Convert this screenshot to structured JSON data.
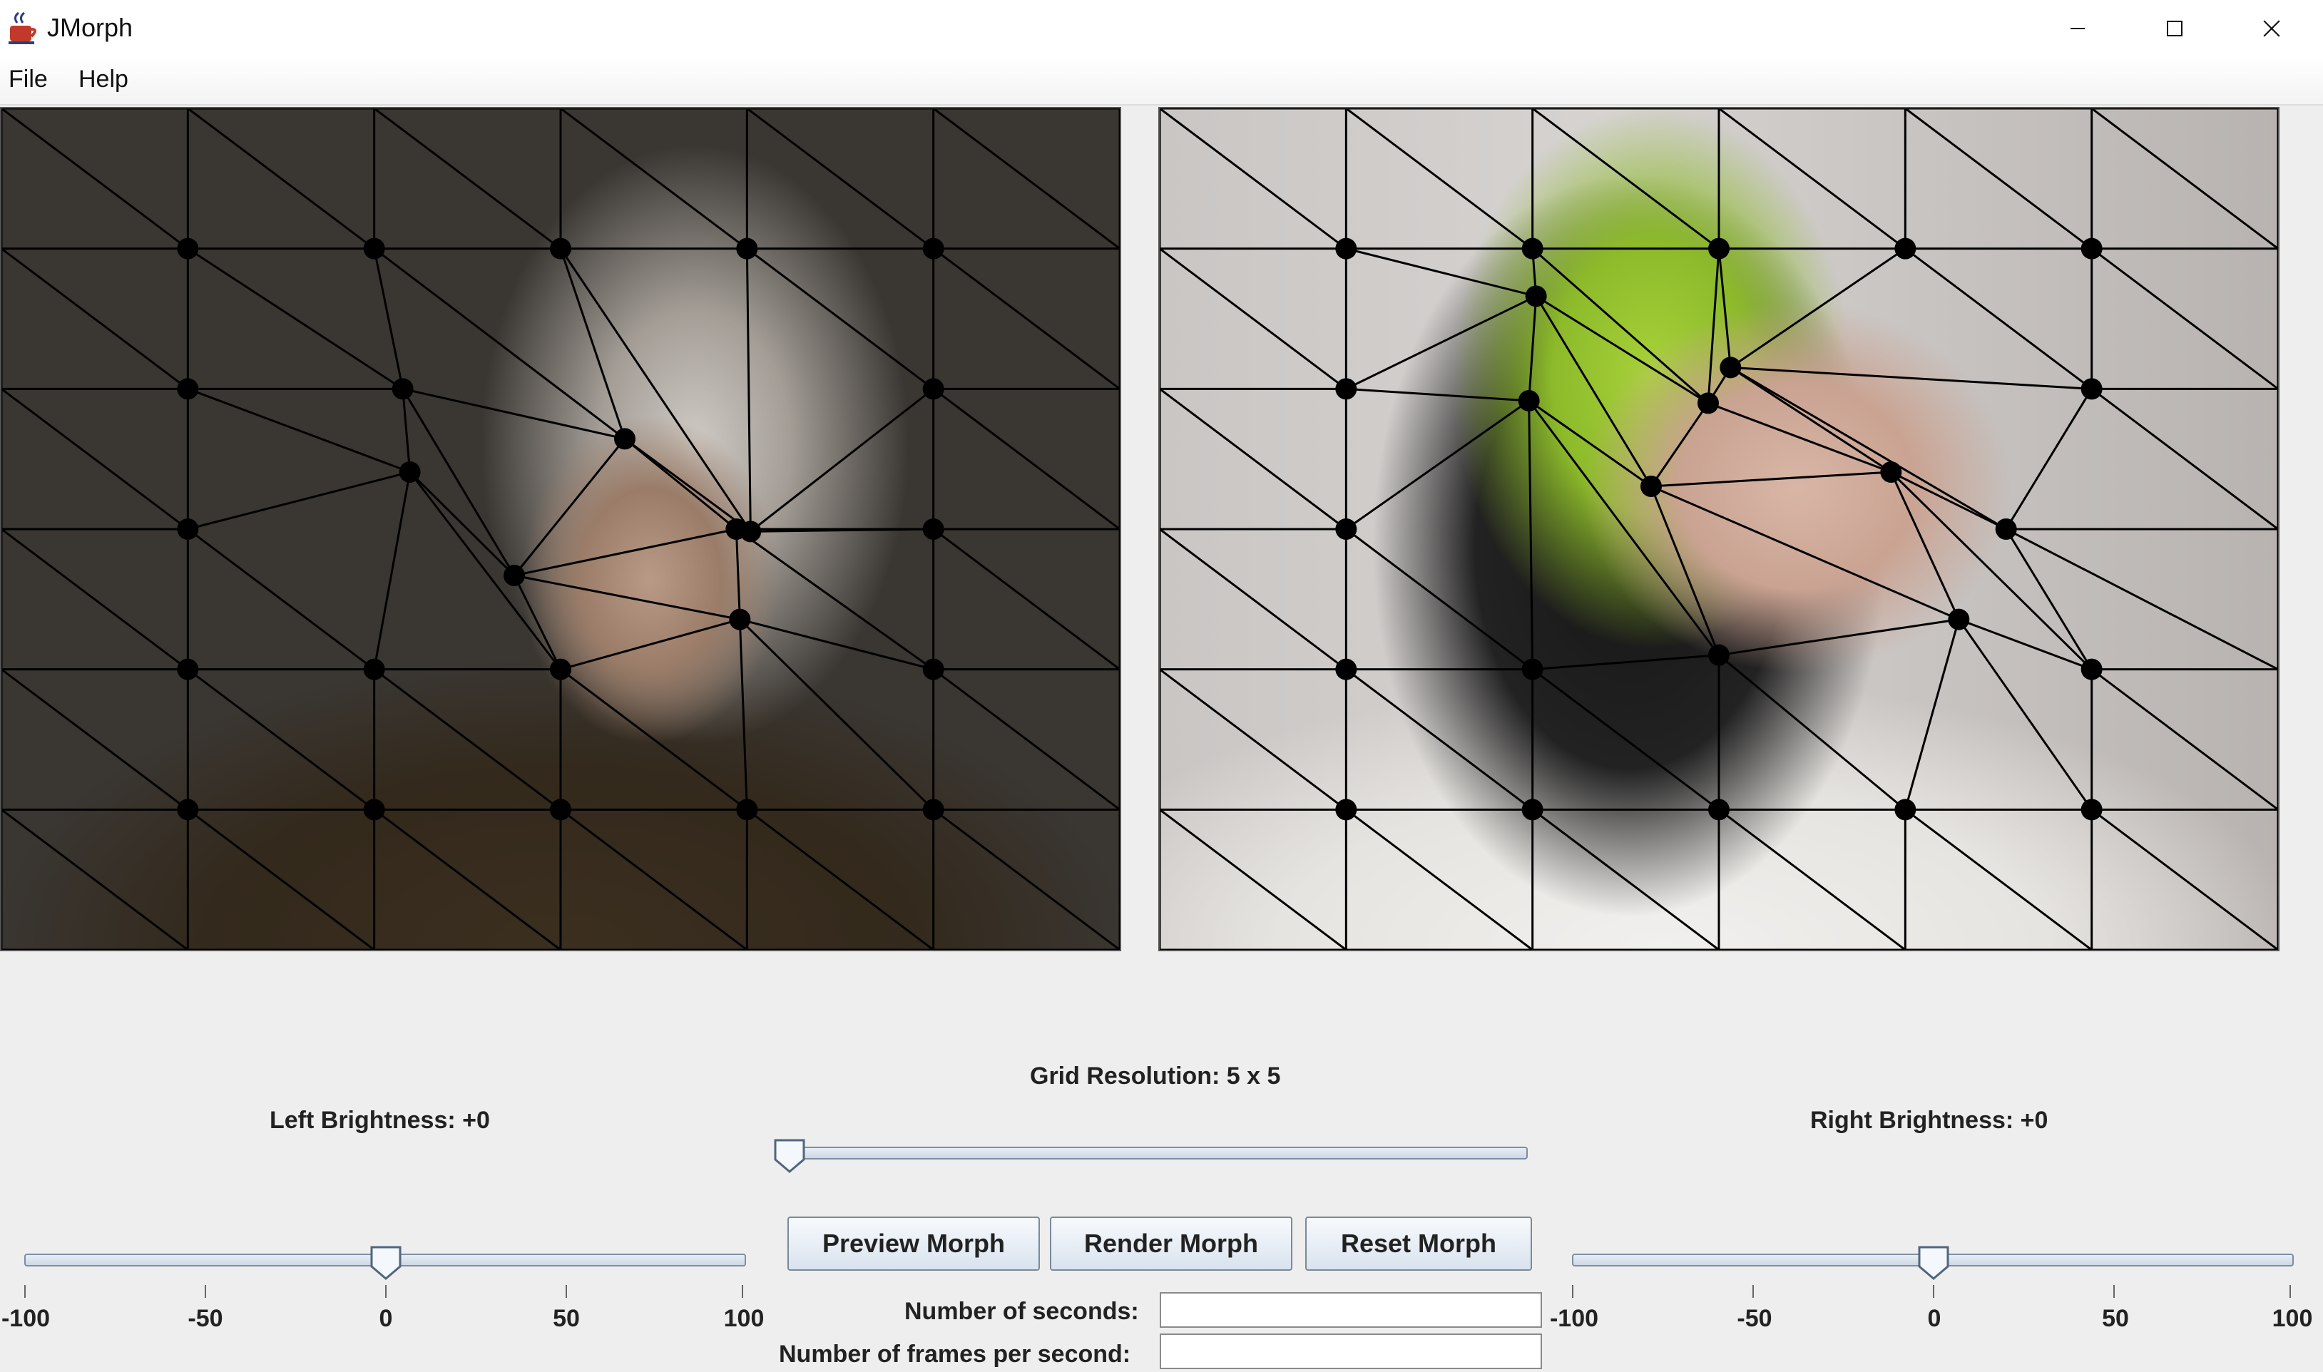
{
  "window": {
    "title": "JMorph",
    "icon": "java-cup-icon",
    "controls": [
      "minimize-icon",
      "maximize-icon",
      "close-icon"
    ]
  },
  "menu": {
    "items": [
      "File",
      "Help"
    ]
  },
  "images": {
    "left": {
      "subject": "portrait-photo",
      "grid": "5 x 5 control point mesh"
    },
    "right": {
      "subject": "portrait-photo",
      "grid": "5 x 5 control point mesh"
    }
  },
  "controls": {
    "grid_resolution_label": "Grid Resolution: 5 x 5",
    "grid_resolution_value": 5,
    "left_brightness_label": "Left Brightness: +0",
    "left_brightness_value": 0,
    "right_brightness_label": "Right Brightness: +0",
    "right_brightness_value": 0,
    "brightness_ticks": [
      "-100",
      "-50",
      "0",
      "50",
      "100"
    ],
    "buttons": {
      "preview": "Preview Morph",
      "render": "Render Morph",
      "reset": "Reset Morph"
    },
    "seconds_label": "Number of seconds:",
    "seconds_value": "",
    "fps_label": "Number of frames per second:",
    "fps_value": ""
  },
  "colors": {
    "mesh_line": "#000000",
    "control_point": "#000000",
    "slider_track": "#cdd8e4",
    "button_face": "#dfe7f0"
  }
}
